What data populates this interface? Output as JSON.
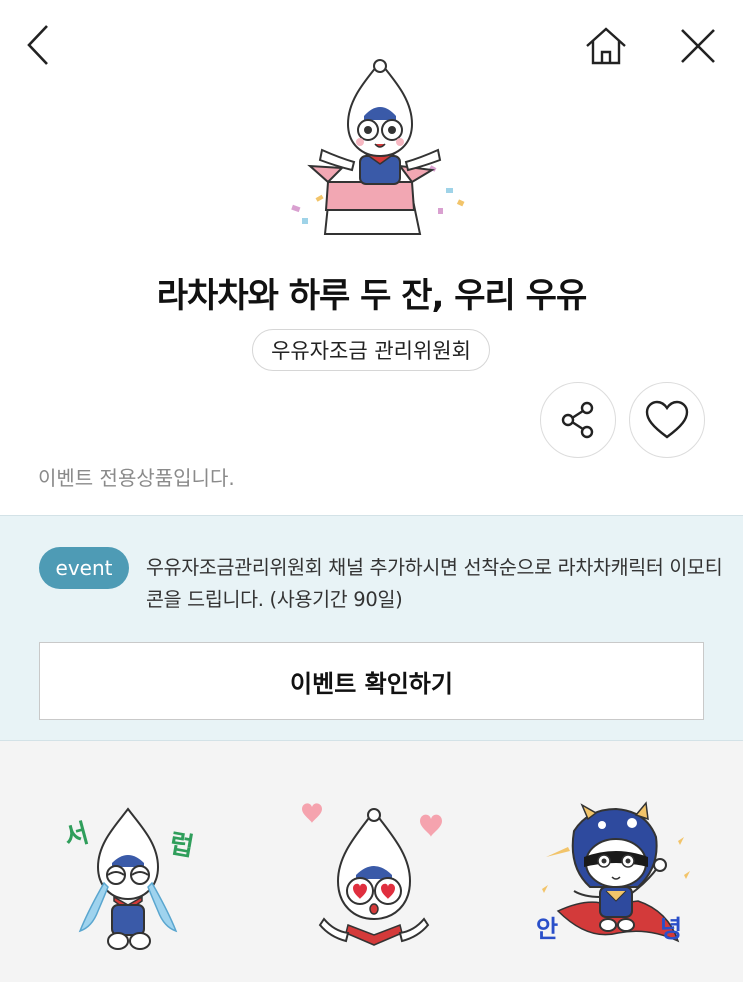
{
  "header": {
    "back_icon": "chevron-left-icon",
    "home_icon": "home-icon",
    "close_icon": "close-icon"
  },
  "product": {
    "title": "라차차와 하루 두 잔, 우리 우유",
    "seller": "우유자조금 관리위원회",
    "notice": "이벤트 전용상품입니다."
  },
  "actions": {
    "share_icon": "share-icon",
    "like_icon": "heart-icon"
  },
  "event": {
    "badge": "event",
    "text": "우유자조금관리위원회 채널 추가하시면 선착순으로 라차차캐릭터 이모티콘을 드립니다. (사용기간 90일)",
    "button_label": "이벤트 확인하기"
  },
  "stickers": [
    {
      "name": "crying-sticker",
      "caption_left": "서",
      "caption_right": "럽",
      "caption_color": "#2f9e5b"
    },
    {
      "name": "heart-eyes-sticker"
    },
    {
      "name": "hero-sticker",
      "caption_left": "안",
      "caption_right": "녕",
      "caption_color": "#2a4fc9"
    }
  ],
  "colors": {
    "accent": "#4e9bb5",
    "panel_bg": "#e8f3f6",
    "sticker_bg": "#f4f4f4"
  }
}
